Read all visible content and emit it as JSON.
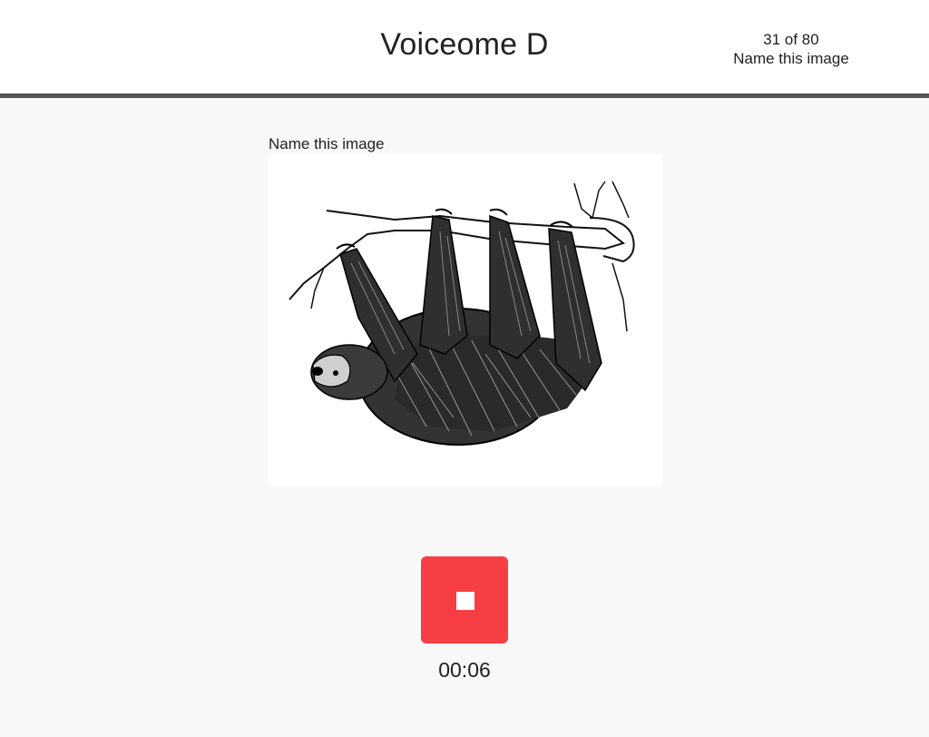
{
  "header": {
    "title": "Voiceome D",
    "progress": {
      "counter": "31 of 80",
      "task_name": "Name this image"
    }
  },
  "task": {
    "prompt": "Name this image",
    "image_subject": "sloth-illustration"
  },
  "recorder": {
    "stop_icon": "stop-icon",
    "elapsed": "00:06",
    "button_color": "#f73e44"
  }
}
